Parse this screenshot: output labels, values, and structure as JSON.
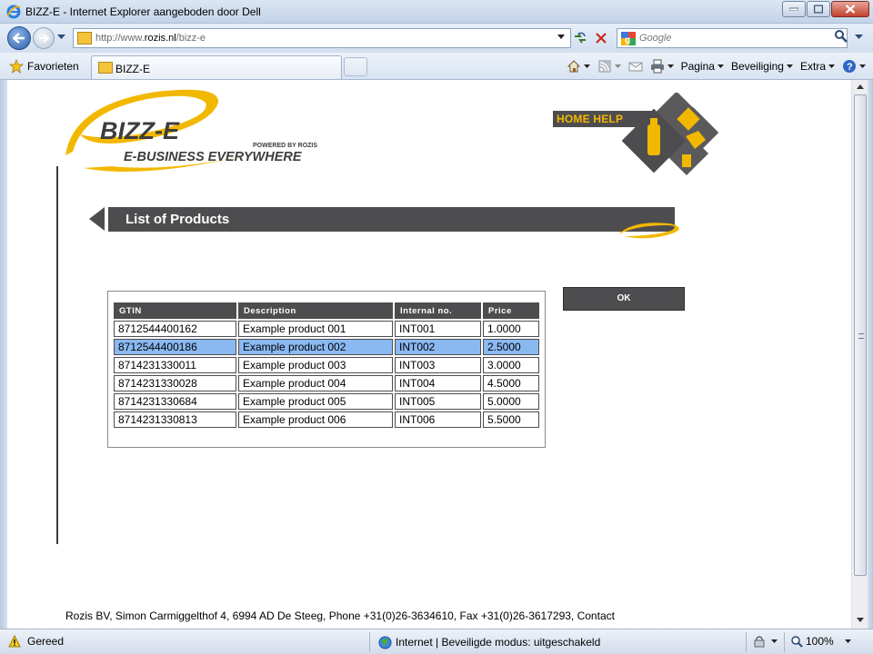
{
  "window": {
    "title": "BIZZ-E - Internet Explorer aangeboden door Dell"
  },
  "addressbar": {
    "url_prefix": "http://www.",
    "url_domain": "rozis.nl",
    "url_path": "/bizz-e",
    "search_placeholder": "Google"
  },
  "favbar": {
    "favorites_label": "Favorieten",
    "tab_title": "BIZZ-E",
    "commands": {
      "page": "Pagina",
      "safety": "Beveiliging",
      "extra": "Extra"
    }
  },
  "page": {
    "logo": {
      "brand": "BIZZ-E",
      "tagline": "E-BUSINESS EVERYWHERE",
      "powered_by": "POWERED BY ROZIS"
    },
    "home_link": "HOME",
    "help_link": "HELP",
    "section_title": "List of Products",
    "ok_label": "OK",
    "footer_text": "Rozis BV, Simon Carmiggelthof 4, 6994 AD De Steeg, Phone +31(0)26-3634610, Fax +31(0)26-3617293,",
    "footer_contact": "Contact",
    "table": {
      "headers": [
        "GTIN",
        "Description",
        "Internal no.",
        "Price"
      ],
      "rows": [
        [
          "8712544400162",
          "Example product 001",
          "INT001",
          "1.0000"
        ],
        [
          "8712544400186",
          "Example product 002",
          "INT002",
          "2.5000"
        ],
        [
          "8714231330011",
          "Example product 003",
          "INT003",
          "3.0000"
        ],
        [
          "8714231330028",
          "Example product 004",
          "INT004",
          "4.5000"
        ],
        [
          "8714231330684",
          "Example product 005",
          "INT005",
          "5.0000"
        ],
        [
          "8714231330813",
          "Example product 006",
          "INT006",
          "5.5000"
        ]
      ],
      "selected_row": 1
    },
    "colors": {
      "accent_yellow": "#f5b800",
      "banner_gray": "#4d4d4f",
      "selection_blue": "#8ab9f2"
    }
  },
  "statusbar": {
    "status": "Gereed",
    "zone": "Internet | Beveiligde modus: uitgeschakeld",
    "zoom": "100%"
  }
}
